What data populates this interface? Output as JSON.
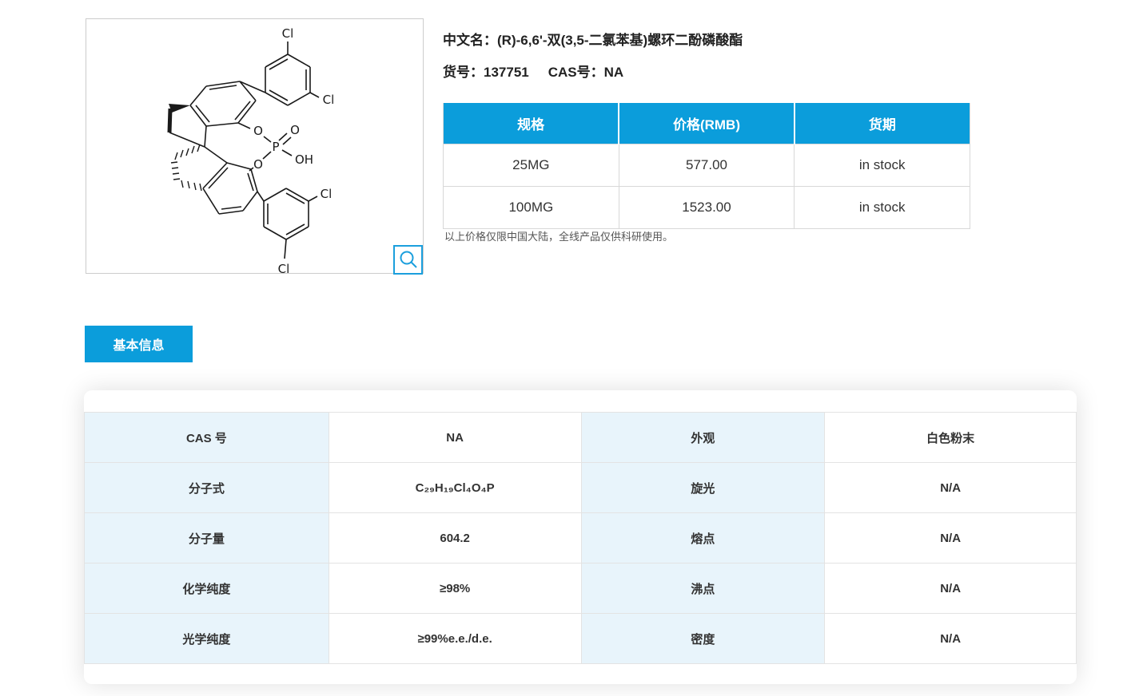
{
  "colors": {
    "primary_blue": "#0b9ddb",
    "label_cell_bg": "#e8f4fb"
  },
  "product": {
    "name_label": "中文名：",
    "name": "(R)-6,6'-双(3,5-二氯苯基)螺环二酚磷酸酯",
    "catalog_label": "货号：",
    "catalog_no": "137751",
    "cas_label": "CAS号：",
    "cas_no": "NA",
    "price_note": "以上价格仅限中国大陆，全线产品仅供科研使用。"
  },
  "structure_image": {
    "description": "chemical structure drawing of spiro diphenol phosphate with two 3,5-dichlorophenyl groups",
    "atoms": {
      "cl": "Cl",
      "o": "O",
      "p": "P",
      "oh": "OH"
    },
    "magnifier_icon": "magnifier"
  },
  "pricing": {
    "headers": [
      "规格",
      "价格(RMB)",
      "货期"
    ],
    "rows": [
      {
        "spec": "25MG",
        "price": "577.00",
        "availability": "in stock"
      },
      {
        "spec": "100MG",
        "price": "1523.00",
        "availability": "in stock"
      }
    ]
  },
  "tabs": {
    "basic_info": "基本信息"
  },
  "basic_info": {
    "rows": [
      {
        "label": "CAS 号",
        "value": "NA",
        "label2": "外观",
        "value2": "白色粉末"
      },
      {
        "label": "分子式",
        "value": "C₂₉H₁₉Cl₄O₄P",
        "label2": "旋光",
        "value2": "N/A"
      },
      {
        "label": "分子量",
        "value": "604.2",
        "label2": "熔点",
        "value2": "N/A"
      },
      {
        "label": "化学纯度",
        "value": "≥98%",
        "label2": "沸点",
        "value2": "N/A"
      },
      {
        "label": "光学纯度",
        "value": "≥99%e.e./d.e.",
        "label2": "密度",
        "value2": "N/A"
      }
    ]
  }
}
